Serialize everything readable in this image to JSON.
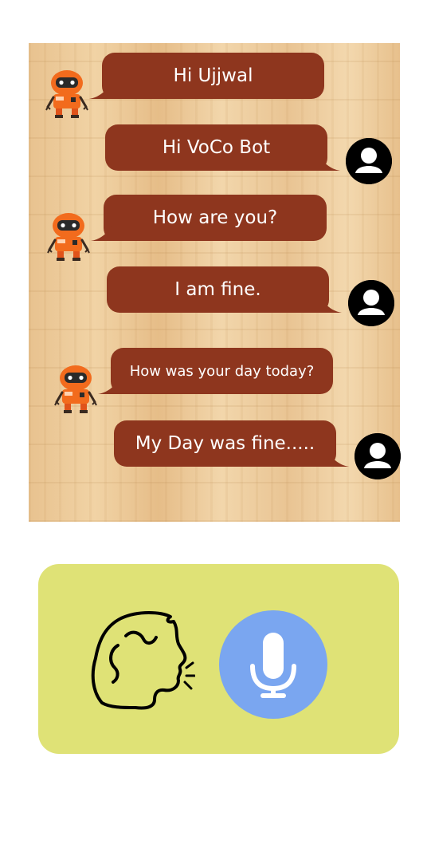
{
  "messages": [
    {
      "sender": "bot",
      "text": "Hi Ujjwal"
    },
    {
      "sender": "user",
      "text": "Hi VoCo Bot"
    },
    {
      "sender": "bot",
      "text": "How are you?"
    },
    {
      "sender": "user",
      "text": "I am fine."
    },
    {
      "sender": "bot",
      "text": "How was your day today?"
    },
    {
      "sender": "user",
      "text": "My Day was fine....."
    }
  ],
  "icons": {
    "bot_avatar": "robot-icon",
    "user_avatar": "user-icon",
    "speaker": "speaking-head-icon",
    "mic": "microphone-icon"
  },
  "colors": {
    "bubble": "#8e361e",
    "bubble_text": "#ffffff",
    "voice_panel": "#dfe276",
    "mic_button": "#7aa6f0",
    "robot": "#f26b1d"
  }
}
